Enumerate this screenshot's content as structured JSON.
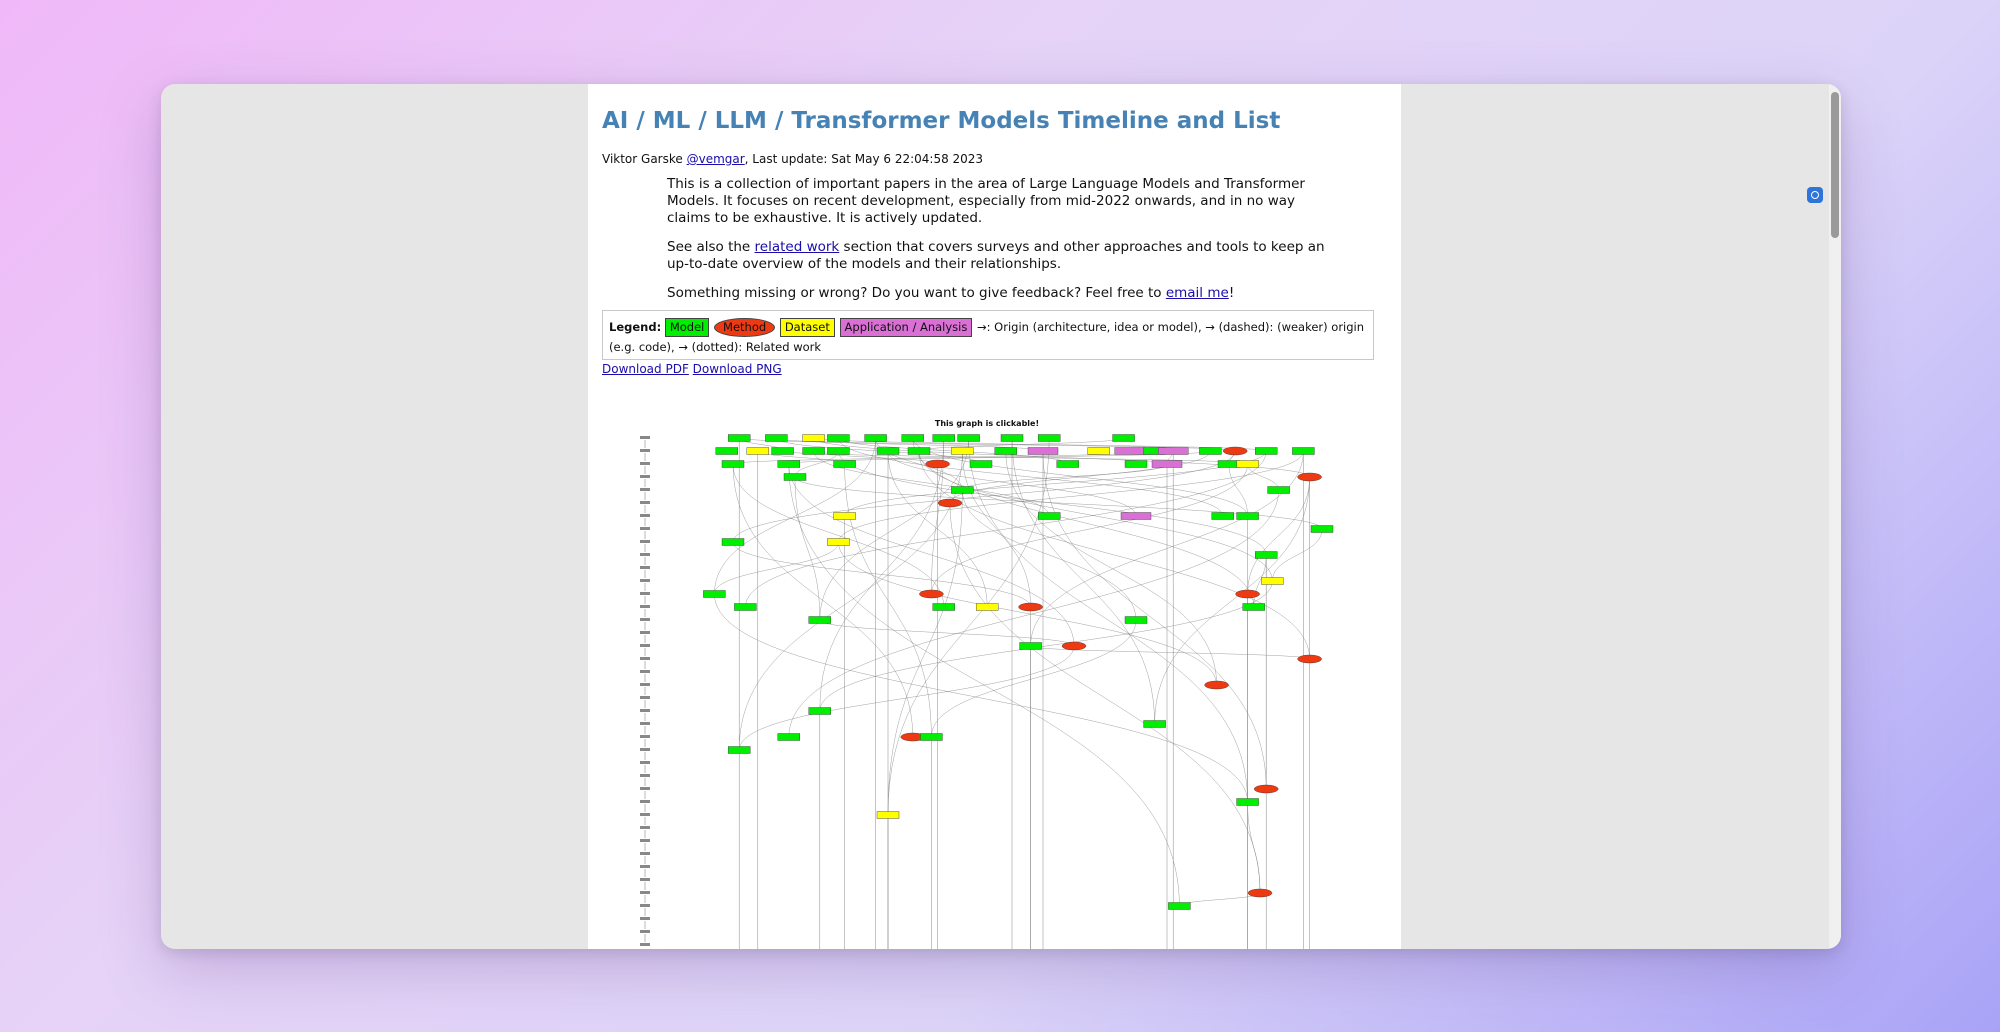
{
  "page": {
    "title": "AI / ML / LLM / Transformer Models Timeline and List",
    "author": "Viktor Garske",
    "handle": "@vemgar",
    "last_update": ", Last update: Sat May 6 22:04:58 2023",
    "intro_p1": "This is a collection of important papers in the area of Large Language Models and Transformer Models. It focuses on recent development, especially from mid-2022 onwards, and in no way claims to be exhaustive. It is actively updated.",
    "intro_p2_before": "See also the ",
    "intro_p2_link": "related work",
    "intro_p2_after": " section that covers surveys and other approaches and tools to keep an up-to-date overview of the models and their relationships.",
    "intro_p3_before": "Something missing or wrong? Do you want to give feedback? Feel free to ",
    "intro_p3_link": "email me",
    "intro_p3_after": "!"
  },
  "legend": {
    "label": "Legend:",
    "model": "Model",
    "method": "Method",
    "dataset": "Dataset",
    "app": "Application / Analysis",
    "text": ": Origin (architecture, idea or model), → (dashed): (weaker) origin (e.g. code), → (dotted): Related work"
  },
  "downloads": {
    "pdf": "Download PDF",
    "png": "Download PNG"
  },
  "graph": {
    "caption": "This graph is clickable!",
    "colors": {
      "model": "#00ee00",
      "method": "#ee3a12",
      "dataset": "#ffff00",
      "app": "#da70d6"
    },
    "nodes": [
      {
        "type": "model",
        "row": 0,
        "col": 0.06
      },
      {
        "type": "model",
        "row": 0,
        "col": 0.12
      },
      {
        "type": "dataset",
        "row": 0,
        "col": 0.18
      },
      {
        "type": "model",
        "row": 0,
        "col": 0.22
      },
      {
        "type": "model",
        "row": 0,
        "col": 0.28
      },
      {
        "type": "model",
        "row": 0,
        "col": 0.34
      },
      {
        "type": "model",
        "row": 0,
        "col": 0.39
      },
      {
        "type": "model",
        "row": 0,
        "col": 0.43
      },
      {
        "type": "model",
        "row": 0,
        "col": 0.5
      },
      {
        "type": "model",
        "row": 0,
        "col": 0.56
      },
      {
        "type": "model",
        "row": 0,
        "col": 0.68
      },
      {
        "type": "model",
        "row": 1,
        "col": 0.04
      },
      {
        "type": "dataset",
        "row": 1,
        "col": 0.09
      },
      {
        "type": "model",
        "row": 1,
        "col": 0.13
      },
      {
        "type": "model",
        "row": 1,
        "col": 0.18
      },
      {
        "type": "model",
        "row": 1,
        "col": 0.22
      },
      {
        "type": "model",
        "row": 1,
        "col": 0.3
      },
      {
        "type": "model",
        "row": 1,
        "col": 0.35
      },
      {
        "type": "dataset",
        "row": 1,
        "col": 0.42
      },
      {
        "type": "model",
        "row": 1,
        "col": 0.49
      },
      {
        "type": "app",
        "row": 1,
        "col": 0.55
      },
      {
        "type": "dataset",
        "row": 1,
        "col": 0.64
      },
      {
        "type": "app",
        "row": 1,
        "col": 0.69
      },
      {
        "type": "model",
        "row": 1,
        "col": 0.73
      },
      {
        "type": "app",
        "row": 1,
        "col": 0.76
      },
      {
        "type": "model",
        "row": 1,
        "col": 0.82
      },
      {
        "type": "method",
        "row": 1,
        "col": 0.86
      },
      {
        "type": "model",
        "row": 1,
        "col": 0.91
      },
      {
        "type": "model",
        "row": 1,
        "col": 0.97
      },
      {
        "type": "model",
        "row": 2,
        "col": 0.05
      },
      {
        "type": "model",
        "row": 2,
        "col": 0.14
      },
      {
        "type": "model",
        "row": 2,
        "col": 0.23
      },
      {
        "type": "method",
        "row": 2,
        "col": 0.38
      },
      {
        "type": "model",
        "row": 2,
        "col": 0.45
      },
      {
        "type": "model",
        "row": 2,
        "col": 0.59
      },
      {
        "type": "model",
        "row": 2,
        "col": 0.7
      },
      {
        "type": "app",
        "row": 2,
        "col": 0.75
      },
      {
        "type": "model",
        "row": 2,
        "col": 0.85
      },
      {
        "type": "dataset",
        "row": 2,
        "col": 0.88
      },
      {
        "type": "model",
        "row": 3,
        "col": 0.15
      },
      {
        "type": "method",
        "row": 3,
        "col": 0.98
      },
      {
        "type": "model",
        "row": 4,
        "col": 0.42
      },
      {
        "type": "model",
        "row": 4,
        "col": 0.93
      },
      {
        "type": "method",
        "row": 5,
        "col": 0.4
      },
      {
        "type": "dataset",
        "row": 6,
        "col": 0.23
      },
      {
        "type": "model",
        "row": 6,
        "col": 0.56
      },
      {
        "type": "app",
        "row": 6,
        "col": 0.7
      },
      {
        "type": "model",
        "row": 6,
        "col": 0.84
      },
      {
        "type": "model",
        "row": 6,
        "col": 0.88
      },
      {
        "type": "model",
        "row": 7,
        "col": 1.0
      },
      {
        "type": "model",
        "row": 8,
        "col": 0.05
      },
      {
        "type": "dataset",
        "row": 8,
        "col": 0.22
      },
      {
        "type": "model",
        "row": 9,
        "col": 0.91
      },
      {
        "type": "dataset",
        "row": 11,
        "col": 0.92
      },
      {
        "type": "model",
        "row": 12,
        "col": 0.02
      },
      {
        "type": "method",
        "row": 12,
        "col": 0.37
      },
      {
        "type": "method",
        "row": 12,
        "col": 0.88
      },
      {
        "type": "model",
        "row": 13,
        "col": 0.07
      },
      {
        "type": "model",
        "row": 13,
        "col": 0.39
      },
      {
        "type": "dataset",
        "row": 13,
        "col": 0.46
      },
      {
        "type": "method",
        "row": 13,
        "col": 0.53
      },
      {
        "type": "model",
        "row": 13,
        "col": 0.89
      },
      {
        "type": "model",
        "row": 14,
        "col": 0.19
      },
      {
        "type": "model",
        "row": 14,
        "col": 0.7
      },
      {
        "type": "model",
        "row": 16,
        "col": 0.53
      },
      {
        "type": "method",
        "row": 16,
        "col": 0.6
      },
      {
        "type": "method",
        "row": 17,
        "col": 0.98
      },
      {
        "type": "method",
        "row": 19,
        "col": 0.83
      },
      {
        "type": "model",
        "row": 21,
        "col": 0.19
      },
      {
        "type": "model",
        "row": 22,
        "col": 0.73
      },
      {
        "type": "model",
        "row": 23,
        "col": 0.14
      },
      {
        "type": "method",
        "row": 23,
        "col": 0.34
      },
      {
        "type": "model",
        "row": 23,
        "col": 0.37
      },
      {
        "type": "model",
        "row": 24,
        "col": 0.06
      },
      {
        "type": "method",
        "row": 27,
        "col": 0.91
      },
      {
        "type": "model",
        "row": 28,
        "col": 0.88
      },
      {
        "type": "dataset",
        "row": 29,
        "col": 0.3
      },
      {
        "type": "method",
        "row": 35,
        "col": 0.9
      },
      {
        "type": "model",
        "row": 36,
        "col": 0.77
      }
    ]
  }
}
